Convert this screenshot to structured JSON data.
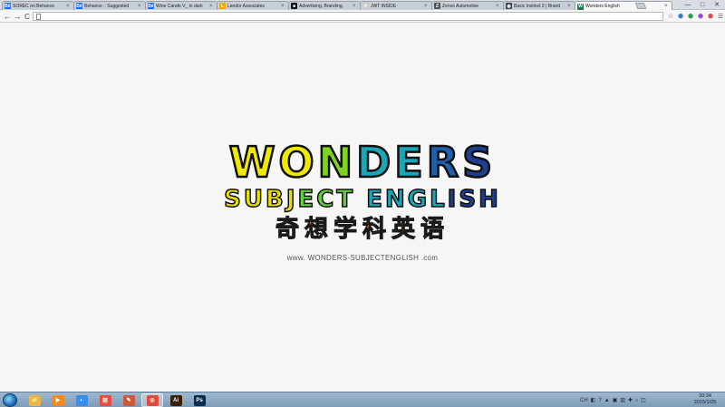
{
  "tabs": [
    {
      "label": "SOREC on Behance",
      "icon": "behance-icon",
      "color": "#1769ff",
      "glyph": "Bē",
      "active": false
    },
    {
      "label": "Behance :: Suggested",
      "icon": "behance-icon",
      "color": "#1769ff",
      "glyph": "Bē",
      "active": false
    },
    {
      "label": "Wine Carafe V_ in dark",
      "icon": "behance-icon",
      "color": "#1769ff",
      "glyph": "Bē",
      "active": false
    },
    {
      "label": "Landor Associates",
      "icon": "landor-icon",
      "color": "#f2a900",
      "glyph": "L",
      "active": false
    },
    {
      "label": "Advertising, Branding,",
      "icon": "agency-icon",
      "color": "#111111",
      "glyph": "■",
      "active": false
    },
    {
      "label": "JWT INSIDE",
      "icon": "jwt-icon",
      "color": "#cfcfcf",
      "glyph": "✦",
      "active": false
    },
    {
      "label": "Zenvo Automotive",
      "icon": "zenvo-icon",
      "color": "#555555",
      "glyph": "Z",
      "active": false
    },
    {
      "label": "Basic Instinct 2 | Brand",
      "icon": "globe-icon",
      "color": "#444444",
      "glyph": "◉",
      "active": false
    },
    {
      "label": "Wonders English",
      "icon": "wonders-icon",
      "color": "#1a7a4a",
      "glyph": "W",
      "active": true
    }
  ],
  "toolbar": {
    "back": "←",
    "forward": "→",
    "reload": "C",
    "url": "",
    "icons": [
      "☆",
      "⬢",
      "⬢",
      "⬢",
      "⬢",
      "☰"
    ]
  },
  "window_controls": [
    "—",
    "□",
    "✕"
  ],
  "logo": {
    "line1": "WONDERS",
    "line2": "SUBJECT ENGLISH",
    "chinese": "奇想学科英语",
    "site": "www. WONDERS-SUBJECTENGLISH .com"
  },
  "colors": {
    "logo_line1_gradient": [
      "#f0e800",
      "#7ed321",
      "#1aa6b7",
      "#1f5fb0",
      "#1e3f8f"
    ],
    "logo_line2_gradient": [
      "#e8e100",
      "#5fcf3a",
      "#1aa6b7",
      "#1e3f8f"
    ],
    "chinese": "#f5a300"
  },
  "taskbar": {
    "apps": [
      {
        "name": "explorer",
        "glyph": "📁",
        "color": "#e8b54a"
      },
      {
        "name": "media-player",
        "glyph": "▶",
        "color": "#f28a1d"
      },
      {
        "name": "qq",
        "glyph": "◐",
        "color": "#3a8ee6"
      },
      {
        "name": "foxmail",
        "glyph": "邮",
        "color": "#e84b3c"
      },
      {
        "name": "paint",
        "glyph": "✎",
        "color": "#cc5a3a"
      },
      {
        "name": "chrome",
        "glyph": "◎",
        "color": "#e04a3a"
      },
      {
        "name": "illustrator",
        "glyph": "Ai",
        "color": "#3a1f00"
      },
      {
        "name": "photoshop",
        "glyph": "Ps",
        "color": "#0b2d4f"
      }
    ],
    "tray": [
      "CH",
      "◧",
      "?",
      "▲",
      "▣",
      "▥",
      "✚",
      "♪",
      "◫"
    ],
    "time": "20:34",
    "date": "2015/1/25"
  }
}
